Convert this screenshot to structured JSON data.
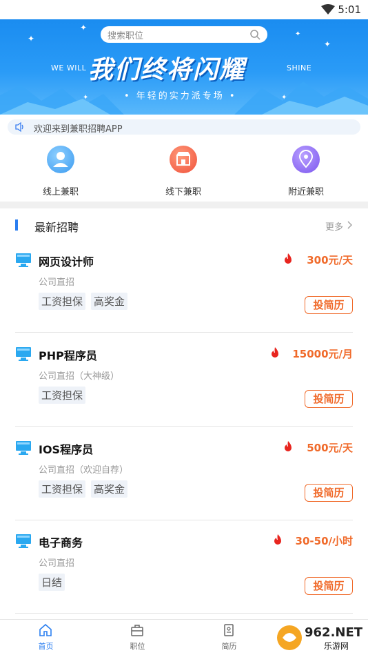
{
  "status_bar": {
    "time": "5:01"
  },
  "search": {
    "placeholder": "搜索职位"
  },
  "banner": {
    "left_text": "WE WILL",
    "right_text": "SHINE",
    "headline": "我们终将闪耀",
    "tagline": "• 年轻的实力派专场 •"
  },
  "notice": {
    "text": "欢迎来到兼职招聘APP"
  },
  "categories": [
    {
      "label": "线上兼职",
      "icon": "person-icon",
      "color": "#4aa8f0"
    },
    {
      "label": "线下兼职",
      "icon": "shop-icon",
      "color": "#f0654a"
    },
    {
      "label": "附近兼职",
      "icon": "location-icon",
      "color": "#8a68f0"
    }
  ],
  "section": {
    "title": "最新招聘",
    "more": "更多"
  },
  "jobs": [
    {
      "name": "网页设计师",
      "salary": "300元/天",
      "company": "公司直招",
      "tags": [
        "工资担保",
        "高奖金"
      ],
      "apply": "投简历"
    },
    {
      "name": "PHP程序员",
      "salary": "15000元/月",
      "company": "公司直招（大神级）",
      "tags": [
        "工资担保"
      ],
      "apply": "投简历"
    },
    {
      "name": "IOS程序员",
      "salary": "500元/天",
      "company": "公司直招（欢迎自荐）",
      "tags": [
        "工资担保",
        "高奖金"
      ],
      "apply": "投简历"
    },
    {
      "name": "电子商务",
      "salary": "30-50/小时",
      "company": "公司直招",
      "tags": [
        "日结"
      ],
      "apply": "投简历"
    }
  ],
  "tabbar": [
    {
      "label": "首页",
      "icon": "home-icon",
      "active": true
    },
    {
      "label": "职位",
      "icon": "briefcase-icon",
      "active": false
    },
    {
      "label": "简历",
      "icon": "resume-icon",
      "active": false
    }
  ],
  "watermark": {
    "brand": "962.NET",
    "sub": "乐游网"
  },
  "colors": {
    "accent": "#2a7ef0",
    "salary": "#f06a2a",
    "fire": "#e8251f",
    "banner": "#1a8cf0"
  }
}
